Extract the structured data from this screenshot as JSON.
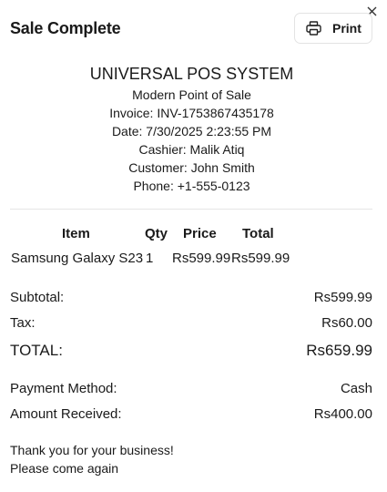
{
  "dialog": {
    "title": "Sale Complete",
    "print_label": "Print",
    "close_icon": "close-icon",
    "print_icon": "printer-icon"
  },
  "receipt": {
    "store_name": "UNIVERSAL POS SYSTEM",
    "tagline": "Modern Point of Sale",
    "invoice": "Invoice: INV-1753867435178",
    "date": "Date: 7/30/2025 2:23:55 PM",
    "cashier": "Cashier: Malik Atiq",
    "customer": "Customer: John Smith",
    "phone": "Phone: +1-555-0123"
  },
  "items_table": {
    "headers": {
      "item": "Item",
      "qty": "Qty",
      "price": "Price",
      "total": "Total"
    },
    "rows": [
      {
        "item": "Samsung Galaxy S23",
        "qty": "1",
        "price": "Rs599.99",
        "total": "Rs599.99"
      }
    ]
  },
  "totals": {
    "subtotal_label": "Subtotal:",
    "subtotal_value": "Rs599.99",
    "tax_label": "Tax:",
    "tax_value": "Rs60.00",
    "total_label": "TOTAL:",
    "total_value": "Rs659.99"
  },
  "payment": {
    "method_label": "Payment Method:",
    "method_value": "Cash",
    "received_label": "Amount Received:",
    "received_value": "Rs400.00"
  },
  "footer": {
    "thanks": "Thank you for your business!",
    "come_again": "Please come again"
  }
}
